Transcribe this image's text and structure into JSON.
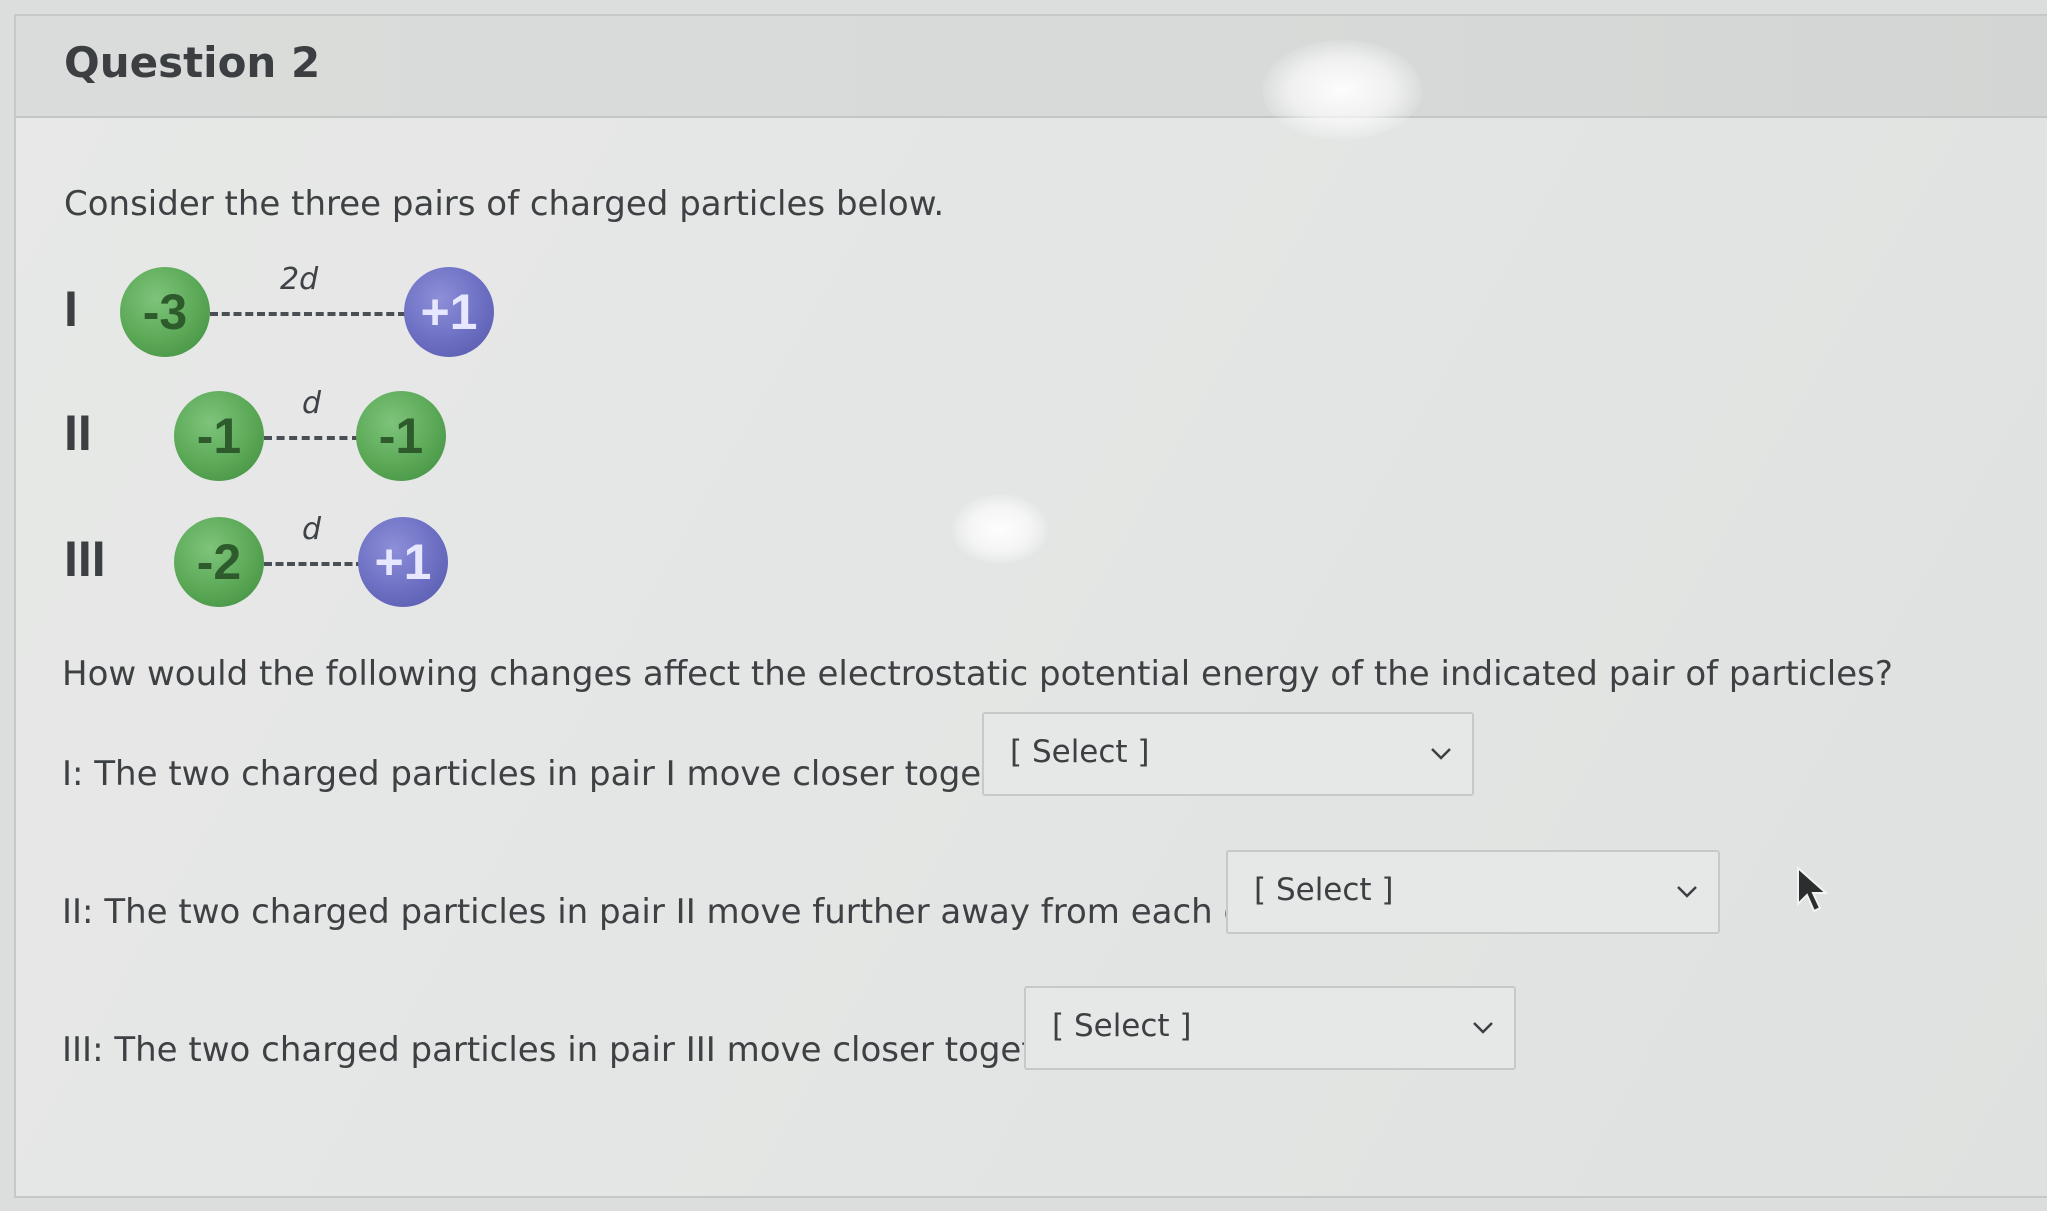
{
  "question": {
    "title": "Question 2",
    "prompt": "Consider the three pairs of charged particles below.",
    "subquestion": "How would the following changes affect the electrostatic potential energy of the indicated pair of particles?"
  },
  "pairs": [
    {
      "roman": "I",
      "left_charge": "-3",
      "right_charge": "+1",
      "separation": "2d"
    },
    {
      "roman": "II",
      "left_charge": "-1",
      "right_charge": "-1",
      "separation": "d"
    },
    {
      "roman": "III",
      "left_charge": "-2",
      "right_charge": "+1",
      "separation": "d"
    }
  ],
  "answers": [
    {
      "text": "I: The two charged particles in pair I move closer together.",
      "select_value": "[ Select ]"
    },
    {
      "text": "II: The two charged particles in pair II move further away from each other.",
      "select_value": "[ Select ]"
    },
    {
      "text": "III: The two charged particles in pair III move closer together.",
      "select_value": "[ Select ]"
    }
  ],
  "colors": {
    "negative_particle": "#5aa856",
    "positive_particle": "#6c6ec2",
    "text": "#3e4144"
  },
  "icons": {
    "dropdown": "chevron-down-icon",
    "pointer": "mouse-pointer-icon"
  }
}
